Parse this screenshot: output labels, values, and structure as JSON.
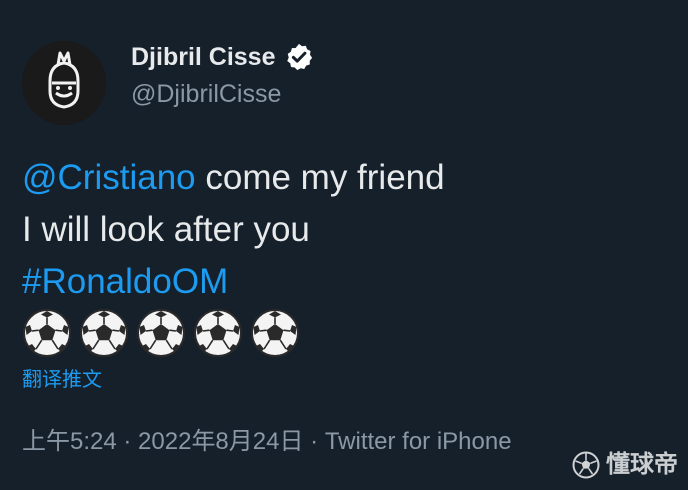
{
  "author": {
    "name": "Djibril Cisse",
    "handle": "@DjibrilCisse",
    "verified": true,
    "avatar_icon": "avatar-icon"
  },
  "tweet": {
    "lines": [
      {
        "mention": "@Cristiano",
        "text": " come my friend"
      },
      {
        "text": "I will look after you"
      },
      {
        "hashtag": "#RonaldoOM"
      }
    ],
    "emoji_count": 5,
    "emoji_name": "soccer-ball-icon",
    "translate_label": "翻译推文"
  },
  "meta": {
    "time": "上午5:24",
    "separator1": " · ",
    "date": "2022年8月24日",
    "separator2": " · ",
    "source": "Twitter for iPhone"
  },
  "watermark": {
    "text": "懂球帝",
    "icon": "soccer-logo-icon"
  },
  "colors": {
    "background": "#15202b",
    "text": "#e7e9ea",
    "muted": "#8b98a5",
    "accent": "#1d9bf0"
  }
}
